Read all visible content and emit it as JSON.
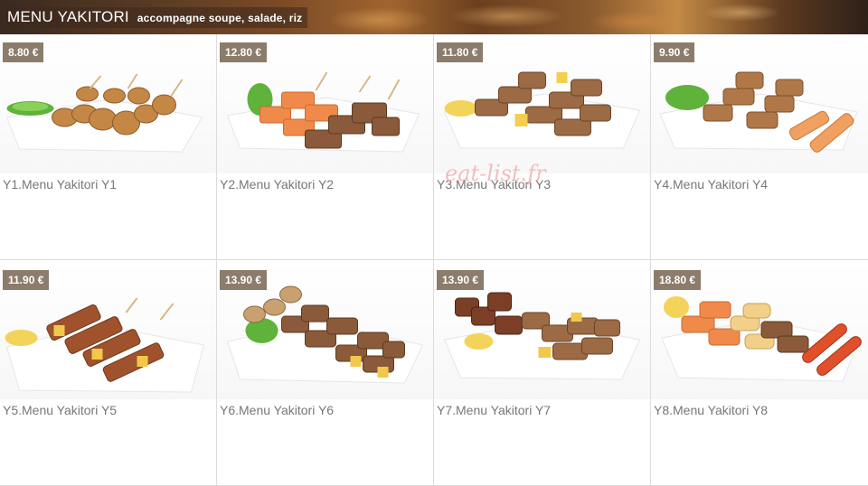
{
  "header": {
    "title": "MENU YAKITORI",
    "subtitle": "accompagne soupe, salade, riz"
  },
  "watermark": "eat-list.fr",
  "items": [
    {
      "price": "8.80 €",
      "name": "Y1.Menu Yakitori Y1"
    },
    {
      "price": "12.80 €",
      "name": "Y2.Menu Yakitori Y2"
    },
    {
      "price": "11.80 €",
      "name": "Y3.Menu Yakitori Y3"
    },
    {
      "price": "9.90 €",
      "name": "Y4.Menu Yakitori Y4"
    },
    {
      "price": "11.90 €",
      "name": "Y5.Menu Yakitori Y5"
    },
    {
      "price": "13.90 €",
      "name": "Y6.Menu Yakitori Y6"
    },
    {
      "price": "13.90 €",
      "name": "Y7.Menu Yakitori Y7"
    },
    {
      "price": "18.80 €",
      "name": "Y8.Menu Yakitori Y8"
    }
  ],
  "colors": {
    "price_badge": "#8c7c6b",
    "label_text": "#777777",
    "watermark": "#f2b3b3"
  }
}
